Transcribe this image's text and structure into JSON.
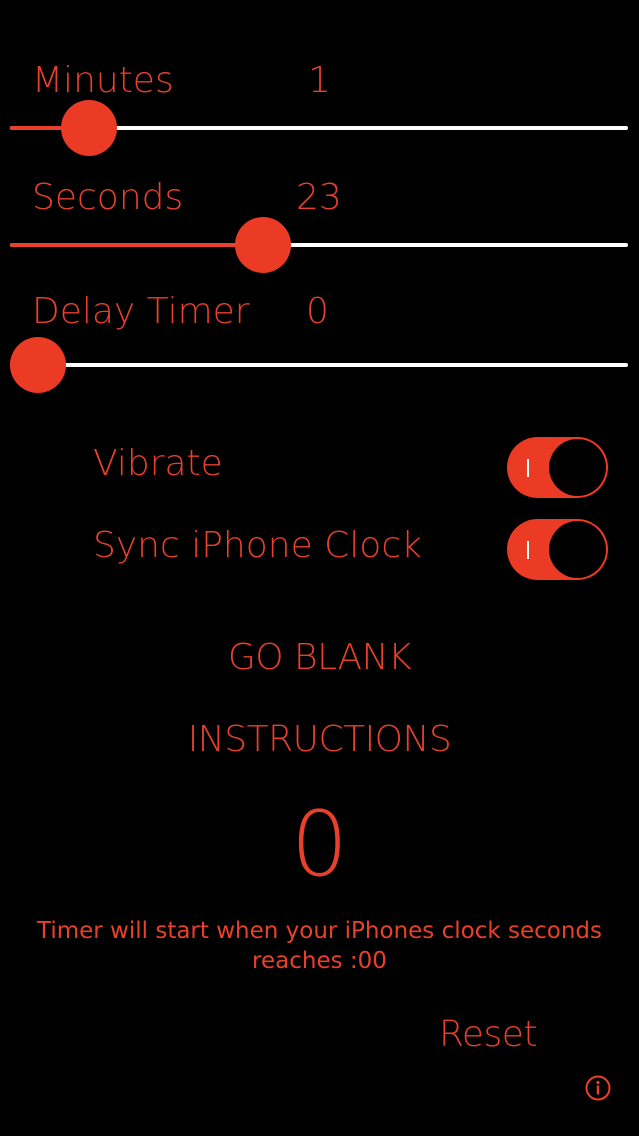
{
  "minutes": {
    "label": "Minutes",
    "value": "1",
    "level": 0.09
  },
  "seconds": {
    "label": "Seconds",
    "value": "23",
    "level": 0.4
  },
  "delay": {
    "label": "Delay Timer",
    "value": "0",
    "level": 0.0
  },
  "vibrate": {
    "label": "Vibrate",
    "on": true
  },
  "sync": {
    "label": "Sync iPhone Clock",
    "on": true
  },
  "buttons": {
    "go_blank": "GO BLANK",
    "instructions": "INSTRUCTIONS",
    "reset": "Reset"
  },
  "counter": "0",
  "message": {
    "line1": "Timer will start when your iPhones clock seconds",
    "line2": "reaches :00"
  },
  "colors": {
    "accent": "#ec3b24",
    "background": "#000000",
    "track": "#ffffff"
  },
  "icons": {
    "info": "info-icon"
  }
}
